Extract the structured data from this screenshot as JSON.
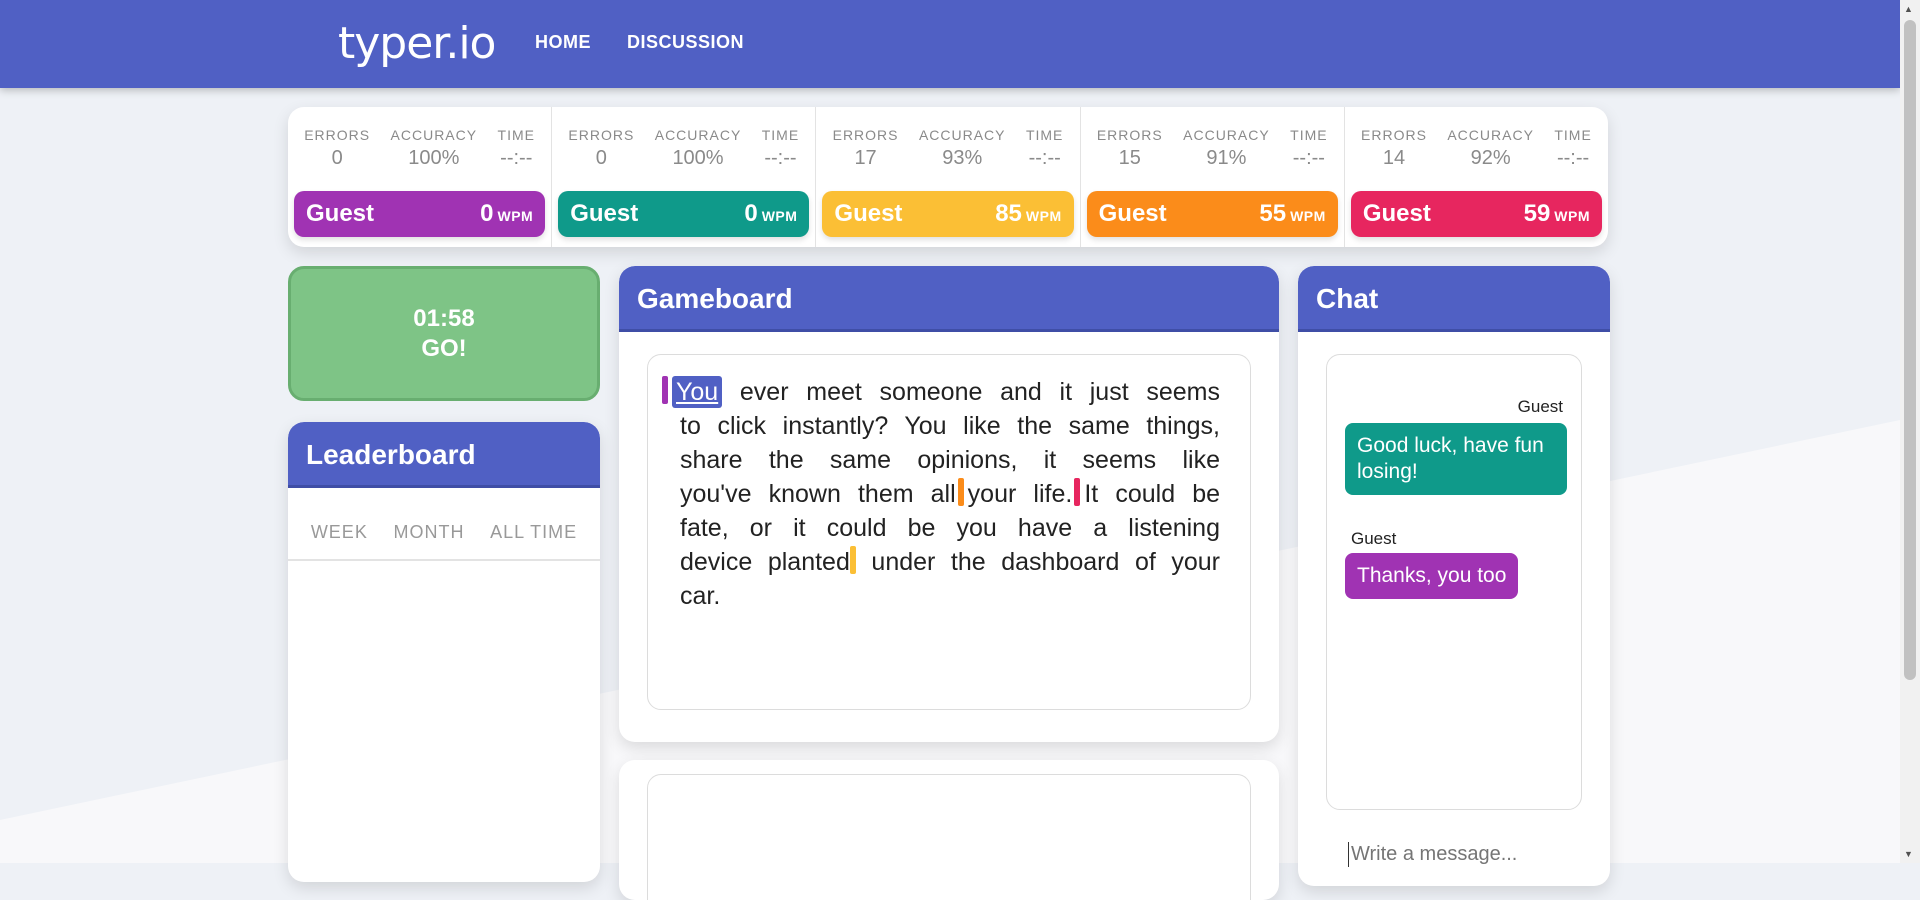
{
  "nav": {
    "brand": "typer.io",
    "links": [
      "HOME",
      "DISCUSSION"
    ]
  },
  "stat_labels": {
    "errors": "ERRORS",
    "accuracy": "ACCURACY",
    "time": "TIME"
  },
  "players": [
    {
      "errors": "0",
      "accuracy": "100%",
      "time": "--:--",
      "name": "Guest",
      "wpm": "0",
      "unit": "WPM",
      "color": "#a033b3"
    },
    {
      "errors": "0",
      "accuracy": "100%",
      "time": "--:--",
      "name": "Guest",
      "wpm": "0",
      "unit": "WPM",
      "color": "#0f9a8a"
    },
    {
      "errors": "17",
      "accuracy": "93%",
      "time": "--:--",
      "name": "Guest",
      "wpm": "85",
      "unit": "WPM",
      "color": "#fbbf35"
    },
    {
      "errors": "15",
      "accuracy": "91%",
      "time": "--:--",
      "name": "Guest",
      "wpm": "55",
      "unit": "WPM",
      "color": "#fb8c1a"
    },
    {
      "errors": "14",
      "accuracy": "92%",
      "time": "--:--",
      "name": "Guest",
      "wpm": "59",
      "unit": "WPM",
      "color": "#e7265f"
    }
  ],
  "timer": {
    "time": "01:58",
    "status": "GO!"
  },
  "leaderboard": {
    "title": "Leaderboard",
    "tabs": [
      "WEEK",
      "MONTH",
      "ALL TIME"
    ]
  },
  "gameboard": {
    "title": "Gameboard",
    "current_word": "You",
    "seg1": " ever meet someone and it just seems to click instantly? You like the same things, share the same opinions, it seems like you've known them all",
    "seg2": "your life.",
    "seg3": "It could be fate, or it could be you have a listening device planted",
    "seg4": " under the dashboard of your car."
  },
  "chat": {
    "title": "Chat",
    "messages": [
      {
        "name": "Guest",
        "text": "Good luck, have fun losing!",
        "color": "#0f9a8a"
      },
      {
        "name": "Guest",
        "text": "Thanks, you too",
        "color": "#a033b3"
      }
    ],
    "input_placeholder": "Write a message..."
  }
}
